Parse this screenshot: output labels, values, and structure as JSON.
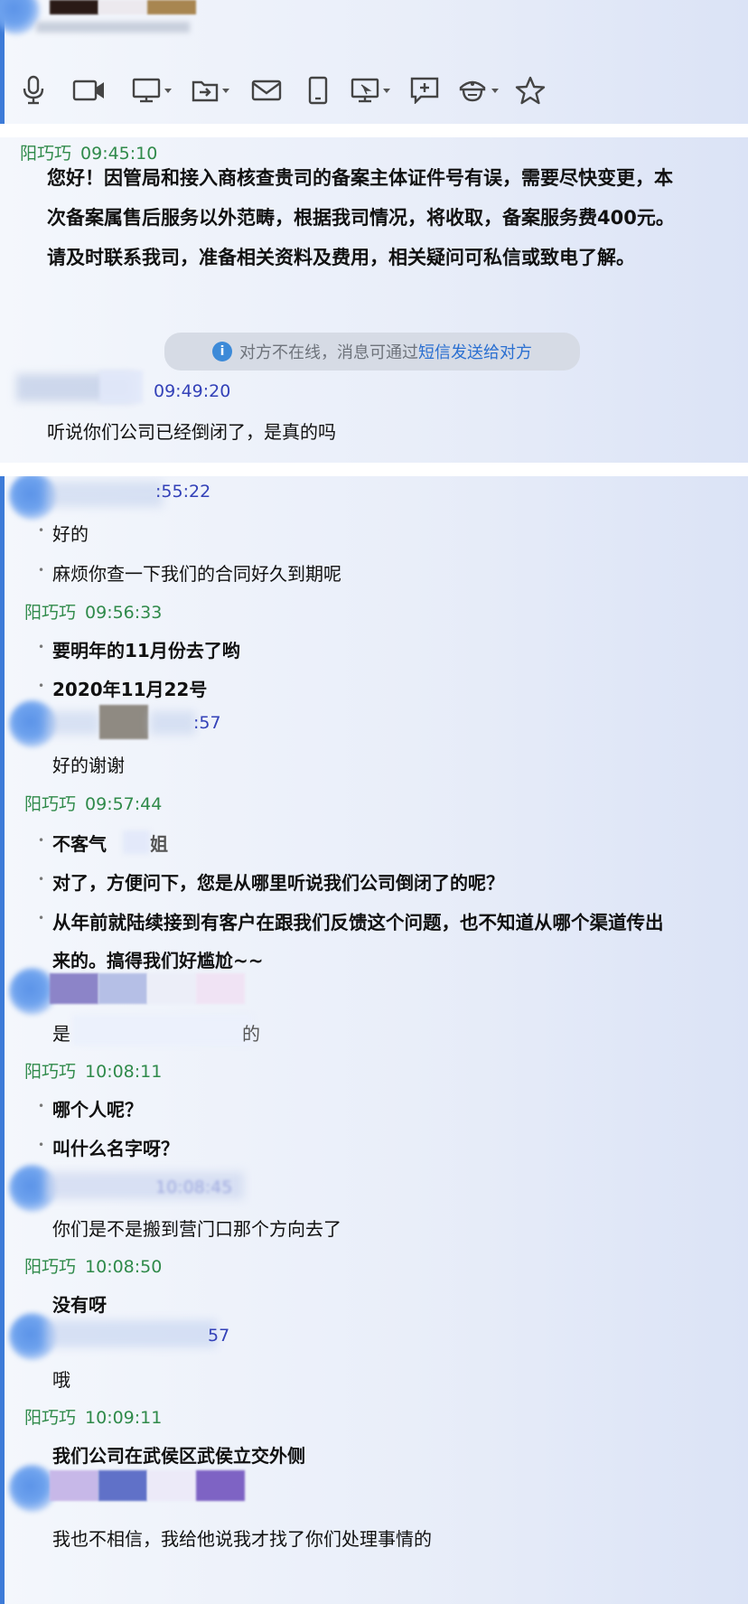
{
  "toolbar": {
    "icons": [
      "microphone-icon",
      "video-camera-icon",
      "screen-share-icon",
      "file-transfer-icon",
      "mail-icon",
      "phone-device-icon",
      "remote-assist-icon",
      "new-chat-icon",
      "app-icon",
      "favorite-star-icon"
    ]
  },
  "chat": {
    "m1": {
      "sender": "阳巧巧",
      "time": "09:45:10",
      "lines": [
        "您好！因管局和接入商核查贵司的备案主体证件号有误，需要尽快变更，本",
        "次备案属售后服务以外范畴，根据我司情况，将收取，备案服务费400元。",
        "请及时联系我司，准备相关资料及费用，相关疑问可私信或致电了解。"
      ]
    },
    "notice": {
      "prefix": "对方不在线，消息可通过",
      "link": "短信发送给对方",
      "icon": "info-icon"
    },
    "m2": {
      "time": "09:49:20",
      "text": "听说你们公司已经倒闭了，是真的吗"
    },
    "m3": {
      "time_fragment": ":55:22",
      "items": [
        "好的",
        "麻烦你查一下我们的合同好久到期呢"
      ]
    },
    "m4": {
      "sender": "阳巧巧",
      "time": "09:56:33",
      "items": [
        "要明年的11月份去了哟",
        "2020年11月22号"
      ]
    },
    "m5": {
      "time_fragment": ":57",
      "text": "好的谢谢"
    },
    "m6": {
      "sender": "阳巧巧",
      "time": "09:57:44",
      "item1": "不客气",
      "item1_tail": "姐",
      "item2": "对了，方便问下，您是从哪里听说我们公司倒闭了的呢？",
      "item3_line1": "从年前就陆续接到有客户在跟我们反馈这个问题，也不知道从哪个渠道传出",
      "item3_line2": "来的。搞得我们好尴尬~~"
    },
    "m7": {
      "text_start": "是",
      "text_end": "的"
    },
    "m8": {
      "sender": "阳巧巧",
      "time": "10:08:11",
      "items": [
        "哪个人呢？",
        "叫什么名字呀？"
      ]
    },
    "m9": {
      "time_fragment": "10:08:45",
      "text": "你们是不是搬到营门口那个方向去了"
    },
    "m10": {
      "sender": "阳巧巧",
      "time": "10:08:50",
      "text": "没有呀"
    },
    "m11": {
      "time_fragment": "57",
      "text": "哦"
    },
    "m12": {
      "sender": "阳巧巧",
      "time": "10:09:11",
      "text": "我们公司在武侯区武侯立交外侧"
    },
    "m13": {
      "text": "我也不相信，我给他说我才找了你们处理事情的"
    }
  }
}
